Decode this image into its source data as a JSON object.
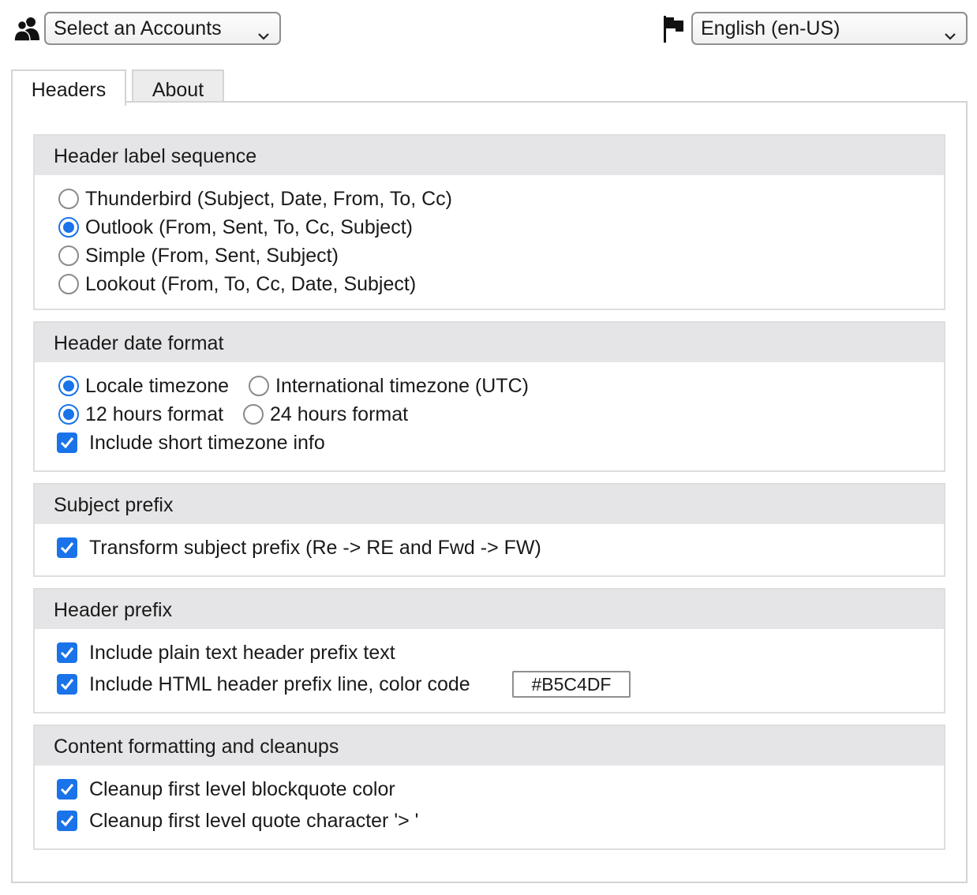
{
  "toolbar": {
    "account_icon": "people-icon",
    "account_select_value": "Select an Accounts",
    "language_icon": "flag-icon",
    "language_select_value": "English (en-US)"
  },
  "tabs": [
    {
      "label": "Headers",
      "selected": true
    },
    {
      "label": "About",
      "selected": false
    }
  ],
  "sections": {
    "label_sequence": {
      "title": "Header label sequence",
      "options": [
        {
          "label": "Thunderbird (Subject, Date, From, To, Cc)",
          "selected": false
        },
        {
          "label": "Outlook (From, Sent, To, Cc, Subject)",
          "selected": true
        },
        {
          "label": "Simple (From, Sent, Subject)",
          "selected": false
        },
        {
          "label": "Lookout (From, To, Cc, Date, Subject)",
          "selected": false
        }
      ]
    },
    "date_format": {
      "title": "Header date format",
      "timezone_locale": "Locale timezone",
      "timezone_utc": "International timezone (UTC)",
      "hours_12": "12 hours format",
      "hours_24": "24 hours format",
      "short_tz": "Include short timezone info",
      "timezone_selected": "locale",
      "hours_selected": "12",
      "short_tz_checked": true
    },
    "subject_prefix": {
      "title": "Subject prefix",
      "transform": "Transform subject prefix (Re -> RE and Fwd -> FW)",
      "transform_checked": true
    },
    "header_prefix": {
      "title": "Header prefix",
      "plain_text": "Include plain text header prefix text",
      "plain_text_checked": true,
      "html_line": "Include HTML header prefix line, color code",
      "html_line_checked": true,
      "color_code": "#B5C4DF"
    },
    "content_formatting": {
      "title": "Content formatting and cleanups",
      "blockquote_color": "Cleanup first level blockquote color",
      "blockquote_color_checked": true,
      "quote_char": "Cleanup first level quote character '> '",
      "quote_char_checked": true
    }
  },
  "colors": {
    "accent": "#1a73e8",
    "section_header_bg": "#e5e5e7",
    "border": "#d4d4d4"
  }
}
